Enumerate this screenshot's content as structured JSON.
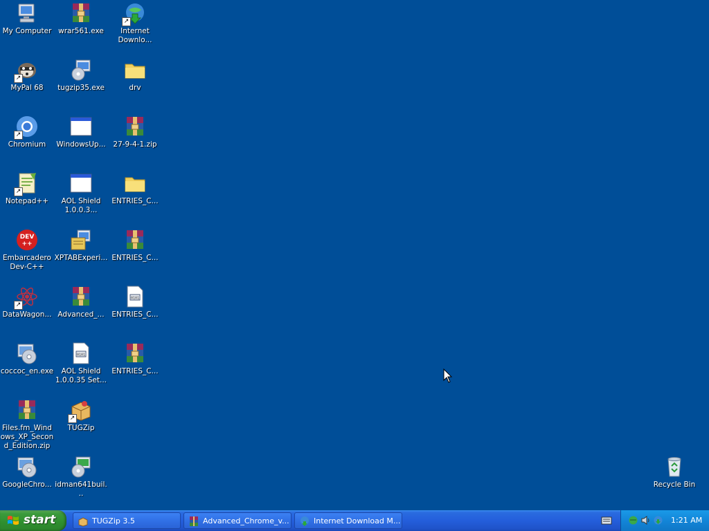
{
  "desktop": {
    "background": "#004e98",
    "icons": [
      {
        "label": "My Computer",
        "icon": "computer-icon"
      },
      {
        "label": "wrar561.exe",
        "icon": "winrar-icon"
      },
      {
        "label": "Internet Downlo...",
        "icon": "idm-icon"
      },
      {
        "label": "MyPal 68",
        "icon": "mypal-icon"
      },
      {
        "label": "tugzip35.exe",
        "icon": "installer-icon"
      },
      {
        "label": "drv",
        "icon": "folder-icon"
      },
      {
        "label": "Chromium",
        "icon": "chromium-icon"
      },
      {
        "label": "WindowsUp...",
        "icon": "window-icon"
      },
      {
        "label": "27-9-4-1.zip",
        "icon": "winrar-icon"
      },
      {
        "label": "Notepad++",
        "icon": "notepadpp-icon"
      },
      {
        "label": "AOL Shield 1.0.0.3...",
        "icon": "window-icon"
      },
      {
        "label": "ENTRIES_C...",
        "icon": "folder-icon"
      },
      {
        "label": "Embarcadero Dev-C++",
        "icon": "devcpp-icon"
      },
      {
        "label": "XPTABExperi...",
        "icon": "installer-icon"
      },
      {
        "label": "ENTRIES_C...",
        "icon": "winrar-icon"
      },
      {
        "label": "DataWagon...",
        "icon": "datawagon-icon"
      },
      {
        "label": "Advanced_...",
        "icon": "winrar-icon"
      },
      {
        "label": "ENTRIES_C...",
        "icon": "document-icon"
      },
      {
        "label": "coccoc_en.exe",
        "icon": "setup-icon"
      },
      {
        "label": "AOL Shield 1.0.0.35 Set...",
        "icon": "document-icon"
      },
      {
        "label": "ENTRIES_C...",
        "icon": "winrar-icon"
      },
      {
        "label": "Files.fm_Windows_XP_Second_Edition.zip",
        "icon": "winrar-icon"
      },
      {
        "label": "TUGZip",
        "icon": "tugzip-icon"
      },
      {
        "label": "GoogleChro...",
        "icon": "setup-icon"
      },
      {
        "label": "idman641buil...",
        "icon": "setup-icon"
      },
      {
        "label": "Recycle Bin",
        "icon": "recycle-bin-icon"
      }
    ]
  },
  "taskbar": {
    "start_label": "start",
    "tasks": [
      {
        "label": "TUGZip 3.5",
        "icon": "tugzip-icon"
      },
      {
        "label": "Advanced_Chrome_v...",
        "icon": "winrar-icon"
      },
      {
        "label": "Internet Download M...",
        "icon": "idm-icon"
      }
    ],
    "clock": "1:21 AM"
  }
}
